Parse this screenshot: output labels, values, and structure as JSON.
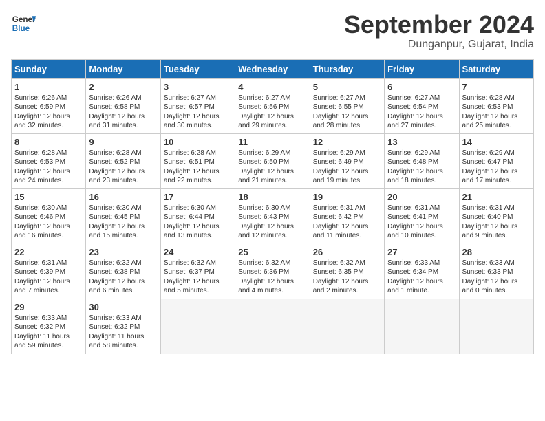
{
  "header": {
    "logo_line1": "General",
    "logo_line2": "Blue",
    "month_title": "September 2024",
    "location": "Dunganpur, Gujarat, India"
  },
  "weekdays": [
    "Sunday",
    "Monday",
    "Tuesday",
    "Wednesday",
    "Thursday",
    "Friday",
    "Saturday"
  ],
  "weeks": [
    [
      {
        "day": "1",
        "info": "Sunrise: 6:26 AM\nSunset: 6:59 PM\nDaylight: 12 hours\nand 32 minutes."
      },
      {
        "day": "2",
        "info": "Sunrise: 6:26 AM\nSunset: 6:58 PM\nDaylight: 12 hours\nand 31 minutes."
      },
      {
        "day": "3",
        "info": "Sunrise: 6:27 AM\nSunset: 6:57 PM\nDaylight: 12 hours\nand 30 minutes."
      },
      {
        "day": "4",
        "info": "Sunrise: 6:27 AM\nSunset: 6:56 PM\nDaylight: 12 hours\nand 29 minutes."
      },
      {
        "day": "5",
        "info": "Sunrise: 6:27 AM\nSunset: 6:55 PM\nDaylight: 12 hours\nand 28 minutes."
      },
      {
        "day": "6",
        "info": "Sunrise: 6:27 AM\nSunset: 6:54 PM\nDaylight: 12 hours\nand 27 minutes."
      },
      {
        "day": "7",
        "info": "Sunrise: 6:28 AM\nSunset: 6:53 PM\nDaylight: 12 hours\nand 25 minutes."
      }
    ],
    [
      {
        "day": "8",
        "info": "Sunrise: 6:28 AM\nSunset: 6:53 PM\nDaylight: 12 hours\nand 24 minutes."
      },
      {
        "day": "9",
        "info": "Sunrise: 6:28 AM\nSunset: 6:52 PM\nDaylight: 12 hours\nand 23 minutes."
      },
      {
        "day": "10",
        "info": "Sunrise: 6:28 AM\nSunset: 6:51 PM\nDaylight: 12 hours\nand 22 minutes."
      },
      {
        "day": "11",
        "info": "Sunrise: 6:29 AM\nSunset: 6:50 PM\nDaylight: 12 hours\nand 21 minutes."
      },
      {
        "day": "12",
        "info": "Sunrise: 6:29 AM\nSunset: 6:49 PM\nDaylight: 12 hours\nand 19 minutes."
      },
      {
        "day": "13",
        "info": "Sunrise: 6:29 AM\nSunset: 6:48 PM\nDaylight: 12 hours\nand 18 minutes."
      },
      {
        "day": "14",
        "info": "Sunrise: 6:29 AM\nSunset: 6:47 PM\nDaylight: 12 hours\nand 17 minutes."
      }
    ],
    [
      {
        "day": "15",
        "info": "Sunrise: 6:30 AM\nSunset: 6:46 PM\nDaylight: 12 hours\nand 16 minutes."
      },
      {
        "day": "16",
        "info": "Sunrise: 6:30 AM\nSunset: 6:45 PM\nDaylight: 12 hours\nand 15 minutes."
      },
      {
        "day": "17",
        "info": "Sunrise: 6:30 AM\nSunset: 6:44 PM\nDaylight: 12 hours\nand 13 minutes."
      },
      {
        "day": "18",
        "info": "Sunrise: 6:30 AM\nSunset: 6:43 PM\nDaylight: 12 hours\nand 12 minutes."
      },
      {
        "day": "19",
        "info": "Sunrise: 6:31 AM\nSunset: 6:42 PM\nDaylight: 12 hours\nand 11 minutes."
      },
      {
        "day": "20",
        "info": "Sunrise: 6:31 AM\nSunset: 6:41 PM\nDaylight: 12 hours\nand 10 minutes."
      },
      {
        "day": "21",
        "info": "Sunrise: 6:31 AM\nSunset: 6:40 PM\nDaylight: 12 hours\nand 9 minutes."
      }
    ],
    [
      {
        "day": "22",
        "info": "Sunrise: 6:31 AM\nSunset: 6:39 PM\nDaylight: 12 hours\nand 7 minutes."
      },
      {
        "day": "23",
        "info": "Sunrise: 6:32 AM\nSunset: 6:38 PM\nDaylight: 12 hours\nand 6 minutes."
      },
      {
        "day": "24",
        "info": "Sunrise: 6:32 AM\nSunset: 6:37 PM\nDaylight: 12 hours\nand 5 minutes."
      },
      {
        "day": "25",
        "info": "Sunrise: 6:32 AM\nSunset: 6:36 PM\nDaylight: 12 hours\nand 4 minutes."
      },
      {
        "day": "26",
        "info": "Sunrise: 6:32 AM\nSunset: 6:35 PM\nDaylight: 12 hours\nand 2 minutes."
      },
      {
        "day": "27",
        "info": "Sunrise: 6:33 AM\nSunset: 6:34 PM\nDaylight: 12 hours\nand 1 minute."
      },
      {
        "day": "28",
        "info": "Sunrise: 6:33 AM\nSunset: 6:33 PM\nDaylight: 12 hours\nand 0 minutes."
      }
    ],
    [
      {
        "day": "29",
        "info": "Sunrise: 6:33 AM\nSunset: 6:32 PM\nDaylight: 11 hours\nand 59 minutes."
      },
      {
        "day": "30",
        "info": "Sunrise: 6:33 AM\nSunset: 6:32 PM\nDaylight: 11 hours\nand 58 minutes."
      },
      {
        "day": "",
        "info": ""
      },
      {
        "day": "",
        "info": ""
      },
      {
        "day": "",
        "info": ""
      },
      {
        "day": "",
        "info": ""
      },
      {
        "day": "",
        "info": ""
      }
    ]
  ]
}
